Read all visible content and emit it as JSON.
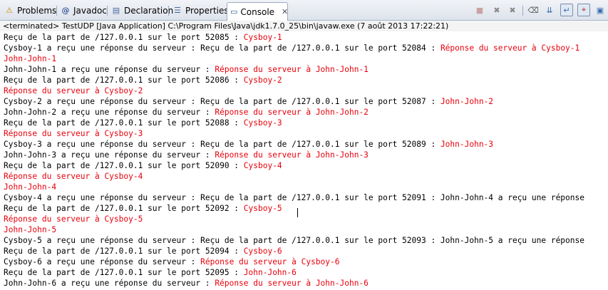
{
  "tabs": [
    {
      "label": "Problems",
      "icon": "problems-icon",
      "glyph": "⚠"
    },
    {
      "label": "Javadoc",
      "icon": "javadoc-icon",
      "glyph": "@"
    },
    {
      "label": "Declaration",
      "icon": "declaration-icon",
      "glyph": "▤"
    },
    {
      "label": "Properties",
      "icon": "properties-icon",
      "glyph": "☰"
    },
    {
      "label": "Console",
      "icon": "console-icon",
      "glyph": "▭",
      "active": true,
      "close": "✕"
    }
  ],
  "toolbar": [
    {
      "name": "terminate-icon",
      "glyph": "■"
    },
    {
      "name": "remove-launch-icon",
      "glyph": "✖"
    },
    {
      "name": "remove-all-terminated-icon",
      "glyph": "✖"
    },
    {
      "name": "clear-console-icon",
      "glyph": "⌫"
    },
    {
      "name": "scroll-lock-icon",
      "glyph": "⇊"
    },
    {
      "name": "word-wrap-icon",
      "glyph": "↵"
    },
    {
      "name": "pin-console-icon",
      "glyph": "⌖"
    },
    {
      "name": "display-console-icon",
      "glyph": "▣"
    }
  ],
  "status": "<terminated> TestUDP [Java Application] C:\\Program Files\\Java\\jdk1.7.0_25\\bin\\javaw.exe (7 août 2013 17:22:21)",
  "lines": [
    [
      {
        "t": "Reçu de la part de /127.0.0.1 sur le port 52085 : "
      },
      {
        "t": "Cysboy-1",
        "r": true
      }
    ],
    [
      {
        "t": "Cysboy-1 a reçu une réponse du serveur : Reçu de la part de /127.0.0.1 sur le port 52084 : "
      },
      {
        "t": "Réponse du serveur à Cysboy-1",
        "r": true
      }
    ],
    [
      {
        "t": "John-John-1",
        "r": true
      }
    ],
    [
      {
        "t": "John-John-1 a reçu une réponse du serveur : "
      },
      {
        "t": "Réponse du serveur à John-John-1",
        "r": true
      }
    ],
    [
      {
        "t": "Reçu de la part de /127.0.0.1 sur le port 52086 : "
      },
      {
        "t": "Cysboy-2",
        "r": true
      }
    ],
    [
      {
        "t": "Réponse du serveur à Cysboy-2",
        "r": true
      }
    ],
    [
      {
        "t": "Cysboy-2 a reçu une réponse du serveur : Reçu de la part de /127.0.0.1 sur le port 52087 : "
      },
      {
        "t": "John-John-2",
        "r": true
      }
    ],
    [
      {
        "t": "John-John-2 a reçu une réponse du serveur : "
      },
      {
        "t": "Réponse du serveur à John-John-2",
        "r": true
      }
    ],
    [
      {
        "t": "Reçu de la part de /127.0.0.1 sur le port 52088 : "
      },
      {
        "t": "Cysboy-3",
        "r": true
      }
    ],
    [
      {
        "t": "Réponse du serveur à Cysboy-3",
        "r": true
      }
    ],
    [
      {
        "t": "Cysboy-3 a reçu une réponse du serveur : Reçu de la part de /127.0.0.1 sur le port 52089 : "
      },
      {
        "t": "John-John-3",
        "r": true
      }
    ],
    [
      {
        "t": "John-John-3 a reçu une réponse du serveur : "
      },
      {
        "t": "Réponse du serveur à John-John-3",
        "r": true
      }
    ],
    [
      {
        "t": "Reçu de la part de /127.0.0.1 sur le port 52090 : "
      },
      {
        "t": "Cysboy-4",
        "r": true
      }
    ],
    [
      {
        "t": "Réponse du serveur à Cysboy-4",
        "r": true
      }
    ],
    [
      {
        "t": "John-John-4",
        "r": true
      }
    ],
    [
      {
        "t": "Cysboy-4 a reçu une réponse du serveur : Reçu de la part de /127.0.0.1 sur le port 52091 : John-John-4 a reçu une réponse"
      }
    ],
    [
      {
        "t": "Reçu de la part de /127.0.0.1 sur le port 52092 : "
      },
      {
        "t": "Cysboy-5",
        "r": true
      }
    ],
    [
      {
        "t": "Réponse du serveur à Cysboy-5",
        "r": true
      }
    ],
    [
      {
        "t": "John-John-5",
        "r": true
      }
    ],
    [
      {
        "t": "Cysboy-5 a reçu une réponse du serveur : Reçu de la part de /127.0.0.1 sur le port 52093 : John-John-5 a reçu une réponse"
      }
    ],
    [
      {
        "t": "Reçu de la part de /127.0.0.1 sur le port 52094 : "
      },
      {
        "t": "Cysboy-6",
        "r": true
      }
    ],
    [
      {
        "t": "Cysboy-6 a reçu une réponse du serveur : "
      },
      {
        "t": "Réponse du serveur à Cysboy-6",
        "r": true
      }
    ],
    [
      {
        "t": "Reçu de la part de /127.0.0.1 sur le port 52095 : "
      },
      {
        "t": "John-John-6",
        "r": true
      }
    ],
    [
      {
        "t": "John-John-6 a reçu une réponse du serveur : "
      },
      {
        "t": "Réponse du serveur à John-John-6",
        "r": true
      }
    ]
  ]
}
